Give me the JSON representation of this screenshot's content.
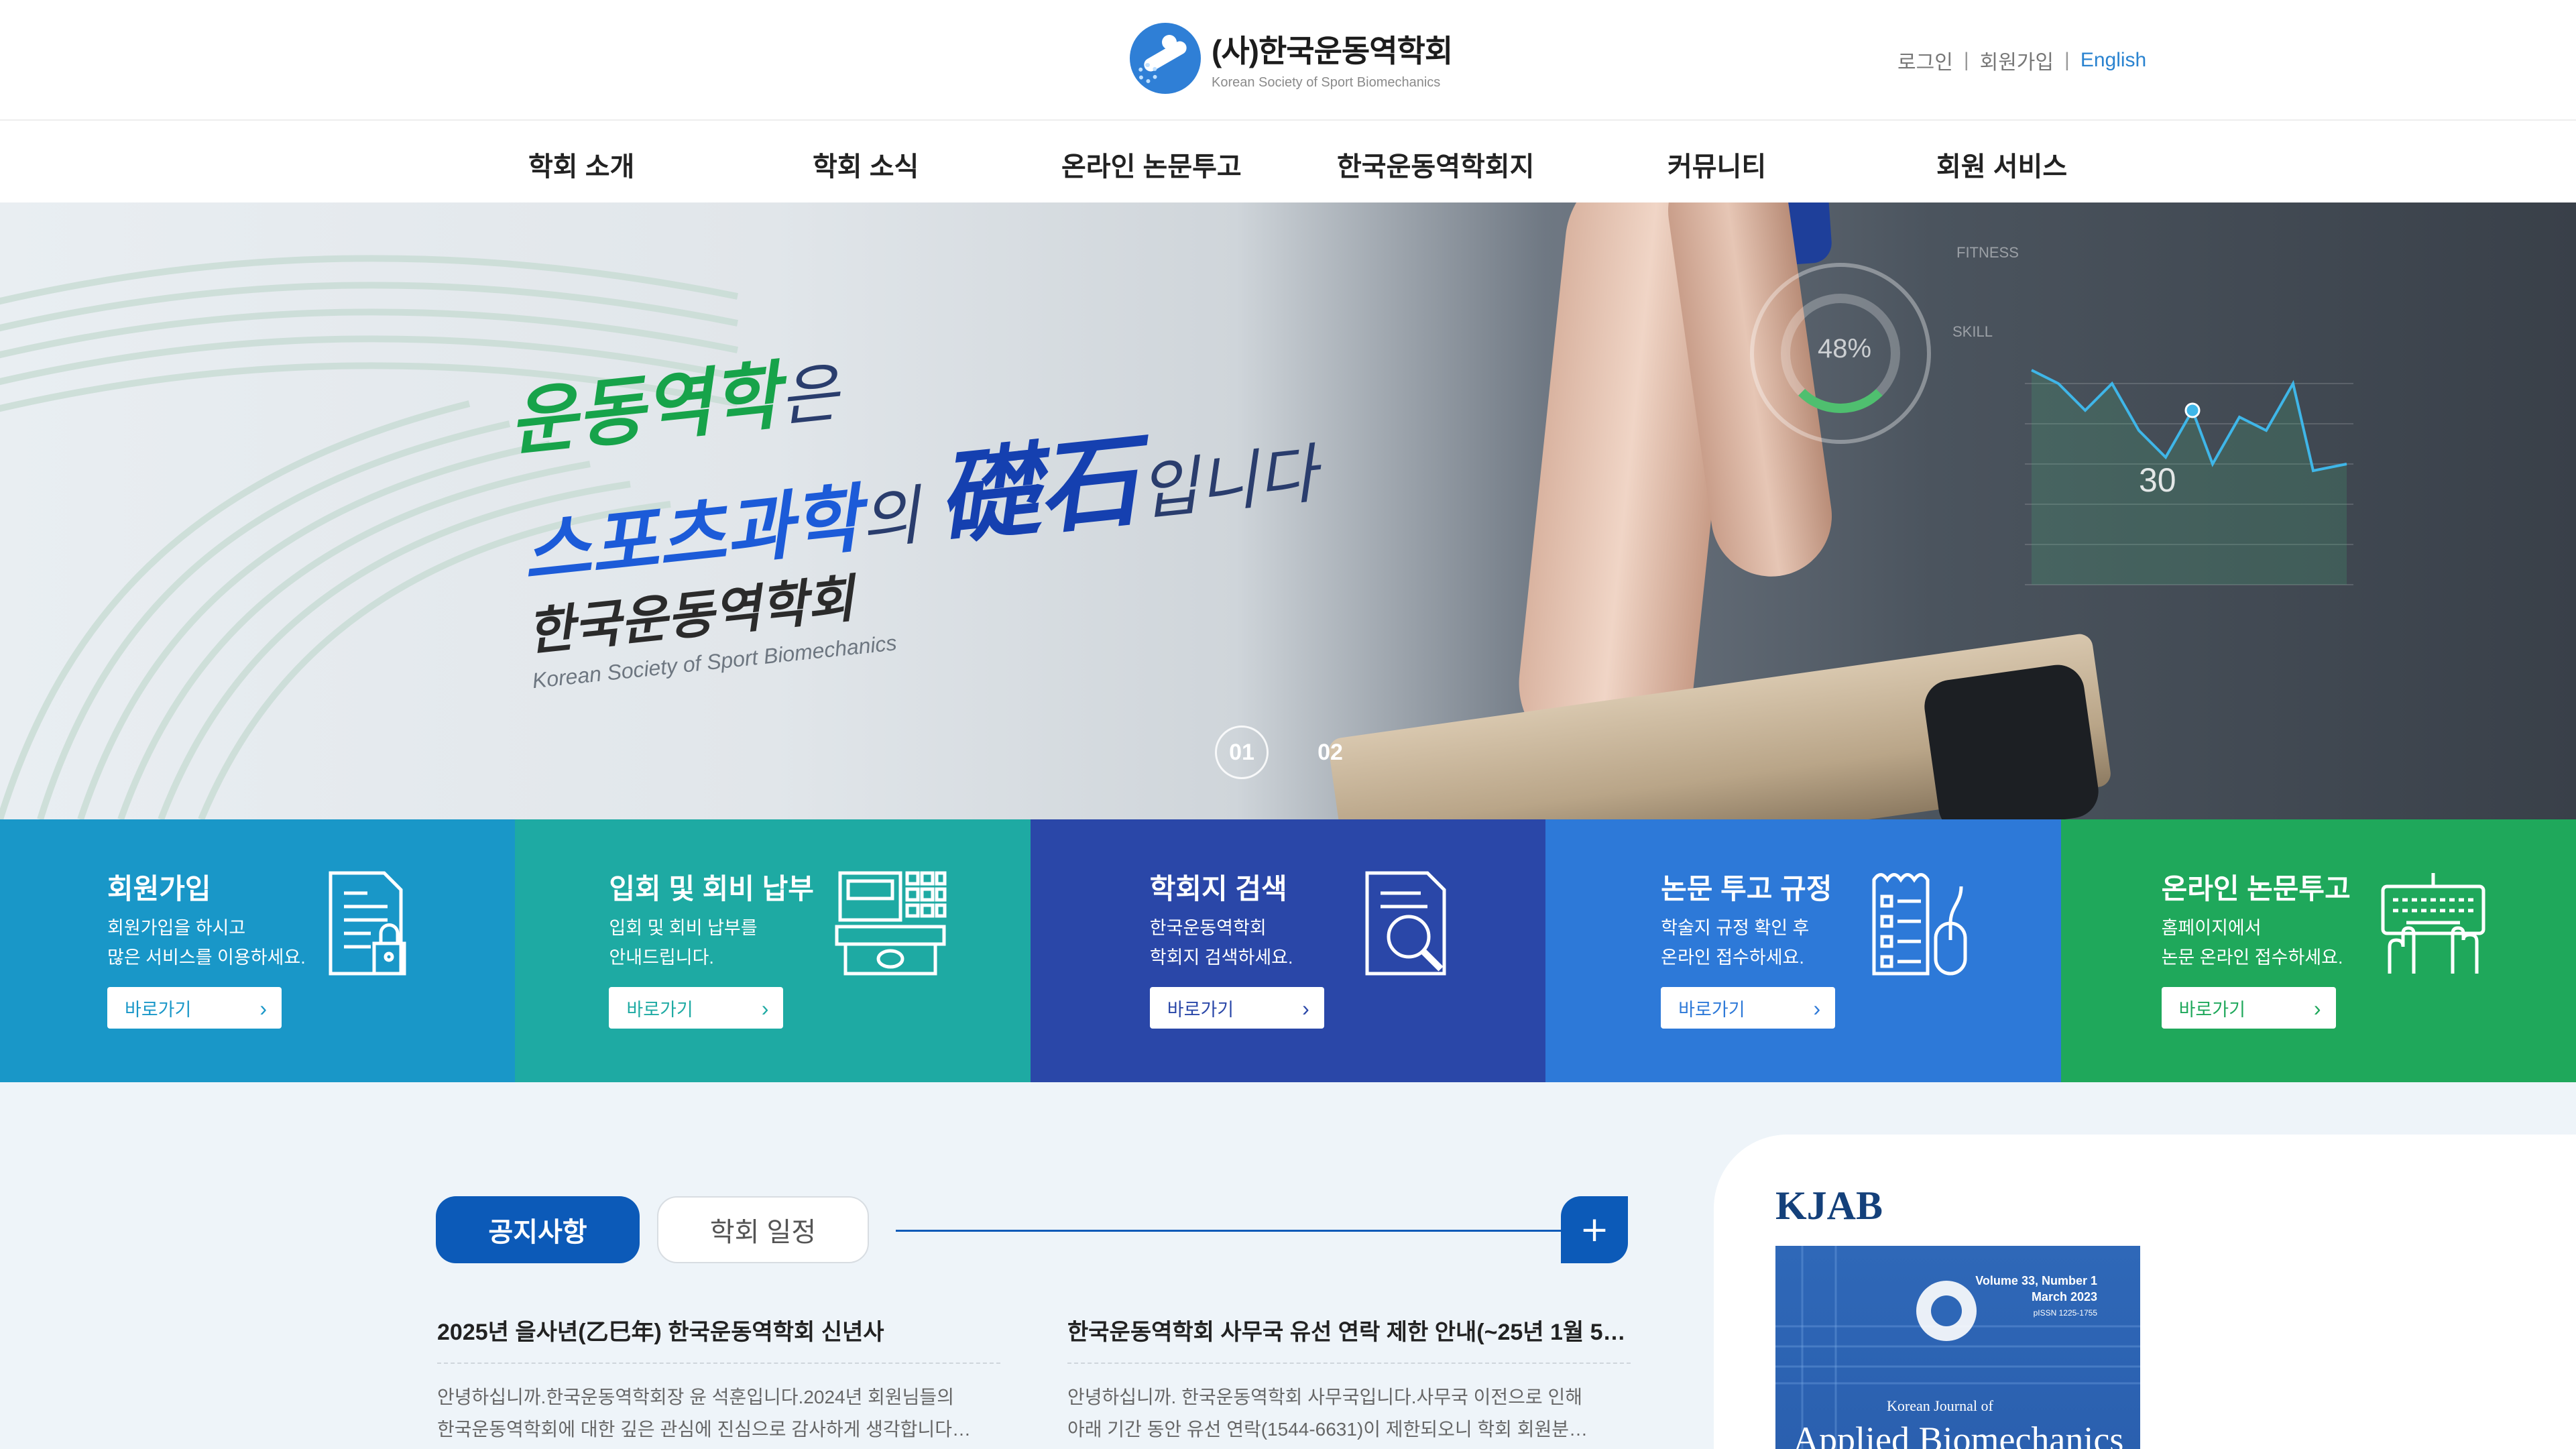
{
  "header": {
    "logo_title": "(사)한국운동역학회",
    "logo_subtitle": "Korean Society of Sport Biomechanics",
    "util": {
      "login": "로그인",
      "signup": "회원가입",
      "english": "English",
      "separator": "|"
    }
  },
  "nav": {
    "items": [
      "학회 소개",
      "학회 소식",
      "온라인 논문투고",
      "한국운동역학회지",
      "커뮤니티",
      "회원 서비스"
    ]
  },
  "hero": {
    "line1_highlight": "운동역학",
    "line1_rest": "은",
    "line2_highlight": "스포츠과학",
    "line2_particle": "의",
    "line2_hanja": "礎石",
    "line2_rest": "입니다",
    "org_korean": "한국운동역학회",
    "org_english": "Korean Society of Sport Biomechanics",
    "hud": {
      "dial_value": "48%",
      "chart_value": "30",
      "label_fitness": "FITNESS",
      "label_skill": "SKILL"
    },
    "pager": [
      "01",
      "02"
    ],
    "pager_active": 0
  },
  "tiles": [
    {
      "title": "회원가입",
      "desc1": "회원가입을 하시고",
      "desc2": "많은 서비스를 이용하세요.",
      "button": "바로가기",
      "icon": "document-lock-icon",
      "color": "#1997c8"
    },
    {
      "title": "입회 및 회비 납부",
      "desc1": "입회 및 회비 납부를",
      "desc2": "안내드립니다.",
      "button": "바로가기",
      "icon": "cash-register-icon",
      "color": "#1eaaa3"
    },
    {
      "title": "학회지 검색",
      "desc1": "한국운동역학회",
      "desc2": "학회지 검색하세요.",
      "button": "바로가기",
      "icon": "document-search-icon",
      "color": "#2a47a8"
    },
    {
      "title": "논문 투고 규정",
      "desc1": "학술지 규정 확인 후",
      "desc2": "온라인 접수하세요.",
      "button": "바로가기",
      "icon": "checklist-mouse-icon",
      "color": "#2d79d8"
    },
    {
      "title": "온라인 논문투고",
      "desc1": "홈페이지에서",
      "desc2": "논문 온라인 접수하세요.",
      "button": "바로가기",
      "icon": "keyboard-typing-icon",
      "color": "#1fa85b"
    }
  ],
  "board": {
    "tab_active": "공지사항",
    "tab_idle": "학회 일정",
    "more": "+",
    "posts": [
      {
        "title": "2025년 을사년(乙巳年) 한국운동역학회 신년사",
        "line1": "안녕하십니까.한국운동역학회장 윤 석훈입니다.2024년 회원님들의",
        "line2": "한국운동역학회에 대한 깊은 관심에 진심으로 감사하게 생각합니다…"
      },
      {
        "title": "한국운동역학회 사무국 유선 연락 제한 안내(~25년 1월 5…",
        "line1": "안녕하십니까. 한국운동역학회 사무국입니다.사무국 이전으로 인해",
        "line2": "아래 기간 동안 유선 연락(1544-6631)이 제한되오니 학회 회원분…"
      }
    ]
  },
  "journal": {
    "label": "KJAB",
    "volume": "Volume 33, Number 1",
    "date": "March 2023",
    "issn": "pISSN 1225-1755",
    "subtitle": "Korean Journal of",
    "title": "Applied Biomechanics"
  },
  "colors": {
    "primary": "#0c5ab8",
    "green": "#17a34a",
    "link": "#2a83d0"
  }
}
